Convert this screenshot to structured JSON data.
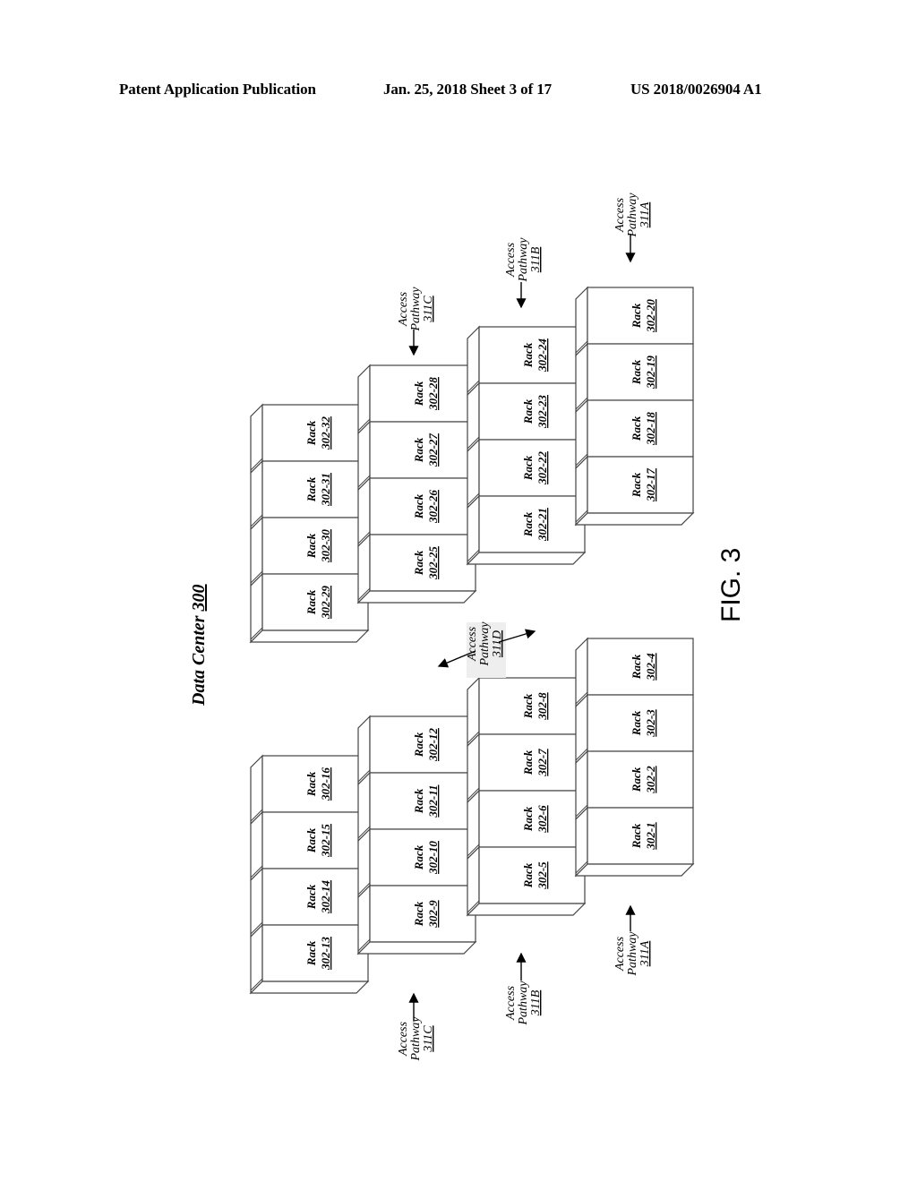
{
  "header": {
    "left": "Patent Application Publication",
    "middle": "Jan. 25, 2018  Sheet 3 of 17",
    "right": "US 2018/0026904 A1"
  },
  "figure": {
    "title_prefix": "Data Center ",
    "title_ref": "300",
    "caption": "FIG. 3",
    "rack_word": "Rack",
    "groups": [
      {
        "name": "lower-group",
        "rows": [
          [
            "302-13",
            "302-14",
            "302-15",
            "302-16"
          ],
          [
            "302-9",
            "302-10",
            "302-11",
            "302-12"
          ],
          [
            "302-5",
            "302-6",
            "302-7",
            "302-8"
          ],
          [
            "302-1",
            "302-2",
            "302-3",
            "302-4"
          ]
        ]
      },
      {
        "name": "upper-group",
        "rows": [
          [
            "302-29",
            "302-30",
            "302-31",
            "302-32"
          ],
          [
            "302-25",
            "302-26",
            "302-27",
            "302-28"
          ],
          [
            "302-21",
            "302-22",
            "302-23",
            "302-24"
          ],
          [
            "302-17",
            "302-18",
            "302-19",
            "302-20"
          ]
        ]
      }
    ],
    "access_pathways": [
      {
        "id": "lower-311C",
        "line1": "Access",
        "line2": "Pathway",
        "ref": "311C",
        "arrow": "right"
      },
      {
        "id": "lower-311B",
        "line1": "Access",
        "line2": "Pathway",
        "ref": "311B",
        "arrow": "right"
      },
      {
        "id": "lower-311A",
        "line1": "Access",
        "line2": "Pathway",
        "ref": "311A",
        "arrow": "right"
      },
      {
        "id": "upper-311C",
        "line1": "Access",
        "line2": "Pathway",
        "ref": "311C",
        "arrow": "left"
      },
      {
        "id": "upper-311B",
        "line1": "Access",
        "line2": "Pathway",
        "ref": "311B",
        "arrow": "left"
      },
      {
        "id": "upper-311A",
        "line1": "Access",
        "line2": "Pathway",
        "ref": "311A",
        "arrow": "left"
      },
      {
        "id": "middle-311D",
        "line1": "Access",
        "line2": "Pathway",
        "ref": "311D",
        "arrow": "both"
      }
    ]
  }
}
